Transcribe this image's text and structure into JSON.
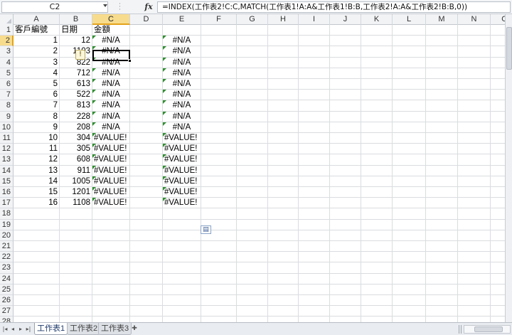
{
  "formula_bar": {
    "name_box": "C2",
    "fx_label": "fx",
    "formula": "=INDEX(工作表2!C:C,MATCH(工作表1!A:A&工作表1!B:B,工作表2!A:A&工作表2!B:B,0))"
  },
  "columns": [
    "A",
    "B",
    "C",
    "D",
    "E",
    "F",
    "G",
    "H",
    "I",
    "J",
    "K",
    "L",
    "M",
    "N",
    "O"
  ],
  "row_numbers": [
    "1",
    "2",
    "3",
    "4",
    "5",
    "6",
    "7",
    "8",
    "9",
    "10",
    "11",
    "12",
    "13",
    "14",
    "15",
    "16",
    "17",
    "18",
    "19",
    "20",
    "21",
    "22",
    "23",
    "24",
    "25",
    "26",
    "27",
    "28"
  ],
  "headers": {
    "a": "客戶編號",
    "b": "日期",
    "c": "金額"
  },
  "rows": [
    {
      "a": "1",
      "b": "12",
      "c": "#N/A",
      "e": "#N/A"
    },
    {
      "a": "2",
      "b": "1103",
      "c": "#N/A",
      "e": "#N/A"
    },
    {
      "a": "3",
      "b": "822",
      "c": "#N/A",
      "e": "#N/A"
    },
    {
      "a": "4",
      "b": "712",
      "c": "#N/A",
      "e": "#N/A"
    },
    {
      "a": "5",
      "b": "613",
      "c": "#N/A",
      "e": "#N/A"
    },
    {
      "a": "6",
      "b": "522",
      "c": "#N/A",
      "e": "#N/A"
    },
    {
      "a": "7",
      "b": "813",
      "c": "#N/A",
      "e": "#N/A"
    },
    {
      "a": "8",
      "b": "228",
      "c": "#N/A",
      "e": "#N/A"
    },
    {
      "a": "9",
      "b": "208",
      "c": "#N/A",
      "e": "#N/A"
    },
    {
      "a": "10",
      "b": "304",
      "c": "#VALUE!",
      "e": "#VALUE!"
    },
    {
      "a": "11",
      "b": "305",
      "c": "#VALUE!",
      "e": "#VALUE!"
    },
    {
      "a": "12",
      "b": "608",
      "c": "#VALUE!",
      "e": "#VALUE!"
    },
    {
      "a": "13",
      "b": "911",
      "c": "#VALUE!",
      "e": "#VALUE!"
    },
    {
      "a": "14",
      "b": "1005",
      "c": "#VALUE!",
      "e": "#VALUE!"
    },
    {
      "a": "15",
      "b": "1201",
      "c": "#VALUE!",
      "e": "#VALUE!"
    },
    {
      "a": "16",
      "b": "1108",
      "c": "#VALUE!",
      "e": "#VALUE!"
    }
  ],
  "sheet_tabs": [
    "工作表1",
    "工作表2",
    "工作表3"
  ],
  "active_sheet": "工作表1",
  "selected_cell": "C2",
  "colors": {
    "selected_header": "#f7dc8e",
    "error_triangle": "#2f8f2f",
    "active_tab_text": "#1f3a6b"
  }
}
